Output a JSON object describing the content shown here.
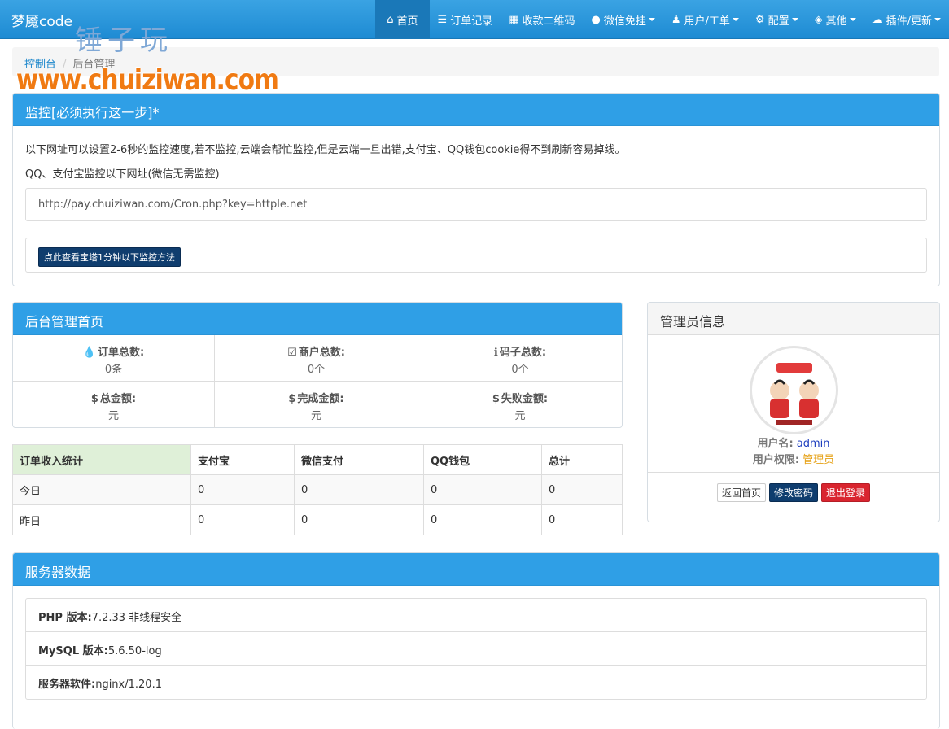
{
  "navbar": {
    "brand": "梦魇code",
    "items": [
      {
        "label": "首页",
        "icon": "home-icon"
      },
      {
        "label": "订单记录",
        "icon": "list-icon"
      },
      {
        "label": "收款二维码",
        "icon": "qrcode-icon"
      },
      {
        "label": "微信免挂",
        "icon": "wechat-icon"
      },
      {
        "label": "用户/工单",
        "icon": "user-icon"
      },
      {
        "label": "配置",
        "icon": "gear-icon"
      },
      {
        "label": "其他",
        "icon": "box-icon"
      },
      {
        "label": "插件/更新",
        "icon": "cloud-icon"
      }
    ]
  },
  "watermark": {
    "cn": "锤子玩",
    "url": "www.chuiziwan.com"
  },
  "breadcrumb": {
    "home": "控制台",
    "current": "后台管理"
  },
  "monitor": {
    "title": "监控[必须执行这一步]*",
    "desc1": "以下网址可以设置2-6秒的监控速度,若不监控,云端会帮忙监控,但是云端一旦出错,支付宝、QQ钱包cookie得不到刷新容易掉线。",
    "desc2": "QQ、支付宝监控以下网址(微信无需监控)",
    "url": "http://pay.chuiziwan.com/Cron.php?key=httple.net",
    "button": "点此查看宝塔1分钟以下监控方法"
  },
  "dashboard": {
    "title": "后台管理首页",
    "stats": [
      {
        "label": "订单总数:",
        "value": "0条",
        "icon": "drop-icon",
        "glyph": "💧"
      },
      {
        "label": "商户总数:",
        "value": "0个",
        "icon": "check-icon",
        "glyph": "☑"
      },
      {
        "label": "码子总数:",
        "value": "0个",
        "icon": "info-icon",
        "glyph": "ℹ"
      },
      {
        "label": "总金额:",
        "value": "元",
        "icon": "dollar-icon",
        "glyph": "$"
      },
      {
        "label": "完成金额:",
        "value": "元",
        "icon": "dollar-icon",
        "glyph": "$"
      },
      {
        "label": "失败金额:",
        "value": "元",
        "icon": "dollar-icon",
        "glyph": "$"
      }
    ]
  },
  "income": {
    "headers": [
      "订单收入统计",
      "支付宝",
      "微信支付",
      "QQ钱包",
      "总计"
    ],
    "rows": [
      [
        "今日",
        "0",
        "0",
        "0",
        "0"
      ],
      [
        "昨日",
        "0",
        "0",
        "0",
        "0"
      ]
    ]
  },
  "admin": {
    "title": "管理员信息",
    "username_label": "用户名:",
    "username": "admin",
    "role_label": "用户权限:",
    "role": "管理员",
    "btn_home": "返回首页",
    "btn_password": "修改密码",
    "btn_logout": "退出登录"
  },
  "server": {
    "title": "服务器数据",
    "items": [
      {
        "label": "PHP 版本:",
        "value": "7.2.33 非线程安全"
      },
      {
        "label": "MySQL 版本:",
        "value": "5.6.50-log"
      },
      {
        "label": "服务器软件:",
        "value": "nginx/1.20.1"
      }
    ]
  }
}
